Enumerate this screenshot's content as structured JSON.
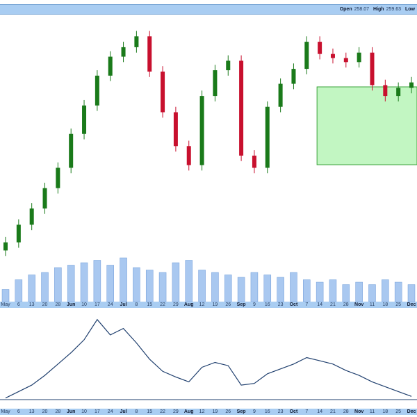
{
  "header": {
    "open_label": "Open",
    "open_value": "258.07",
    "high_label": "High",
    "high_value": "259.63",
    "low_label": "Low",
    "low_value": ""
  },
  "colors": {
    "up": "#1a7a1a",
    "down": "#c8102e",
    "volume": "#a9c8f0",
    "line": "#1f3f6e",
    "highlight_fill": "#90ee90",
    "axis_bar": "#a9cdf2"
  },
  "x_axis_ticks": [
    {
      "label": "May",
      "month": false
    },
    {
      "label": "6",
      "month": false
    },
    {
      "label": "13",
      "month": false
    },
    {
      "label": "20",
      "month": false
    },
    {
      "label": "28",
      "month": false
    },
    {
      "label": "Jun",
      "month": true
    },
    {
      "label": "10",
      "month": false
    },
    {
      "label": "17",
      "month": false
    },
    {
      "label": "24",
      "month": false
    },
    {
      "label": "Jul",
      "month": true
    },
    {
      "label": "8",
      "month": false
    },
    {
      "label": "15",
      "month": false
    },
    {
      "label": "22",
      "month": false
    },
    {
      "label": "29",
      "month": false
    },
    {
      "label": "Aug",
      "month": true
    },
    {
      "label": "12",
      "month": false
    },
    {
      "label": "19",
      "month": false
    },
    {
      "label": "26",
      "month": false
    },
    {
      "label": "Sep",
      "month": true
    },
    {
      "label": "9",
      "month": false
    },
    {
      "label": "16",
      "month": false
    },
    {
      "label": "23",
      "month": false
    },
    {
      "label": "Oct",
      "month": true
    },
    {
      "label": "7",
      "month": false
    },
    {
      "label": "14",
      "month": false
    },
    {
      "label": "21",
      "month": false
    },
    {
      "label": "28",
      "month": false
    },
    {
      "label": "Nov",
      "month": true
    },
    {
      "label": "11",
      "month": false
    },
    {
      "label": "18",
      "month": false
    },
    {
      "label": "25",
      "month": false
    },
    {
      "label": "Dec",
      "month": true
    }
  ],
  "chart_data": {
    "type": "candlestick",
    "title": "",
    "xlabel": "",
    "ylabel": "",
    "grid": false,
    "legend": "none",
    "categories": [
      "May",
      "6",
      "13",
      "20",
      "28",
      "Jun",
      "10",
      "17",
      "24",
      "Jul",
      "8",
      "15",
      "22",
      "29",
      "Aug",
      "12",
      "19",
      "26",
      "Sep",
      "9",
      "16",
      "23",
      "Oct",
      "7",
      "14",
      "21",
      "28",
      "Nov",
      "11",
      "18",
      "25",
      "Dec"
    ],
    "highlight_box": {
      "from": "14",
      "to": "Dec"
    },
    "series": [
      {
        "values": [
          34,
          47,
          59,
          74,
          89,
          114,
          135,
          157,
          171,
          178,
          186,
          160,
          130,
          105,
          91,
          142,
          161,
          168,
          98,
          89,
          134,
          151,
          162,
          182,
          173,
          170,
          167,
          174,
          150,
          142,
          148,
          152
        ]
      },
      {
        "values": [
          5,
          9,
          11,
          12,
          14,
          15,
          16,
          17,
          15,
          18,
          14,
          13,
          12,
          16,
          17,
          13,
          12,
          11,
          10,
          12,
          11,
          10,
          12,
          9,
          8,
          9,
          7,
          8,
          7,
          9,
          8,
          7
        ]
      },
      {
        "values": [
          2,
          10,
          18,
          30,
          44,
          58,
          74,
          99,
          80,
          88,
          70,
          50,
          35,
          28,
          22,
          40,
          46,
          42,
          18,
          20,
          32,
          38,
          44,
          52,
          48,
          44,
          36,
          30,
          22,
          16,
          10,
          4
        ]
      }
    ]
  }
}
